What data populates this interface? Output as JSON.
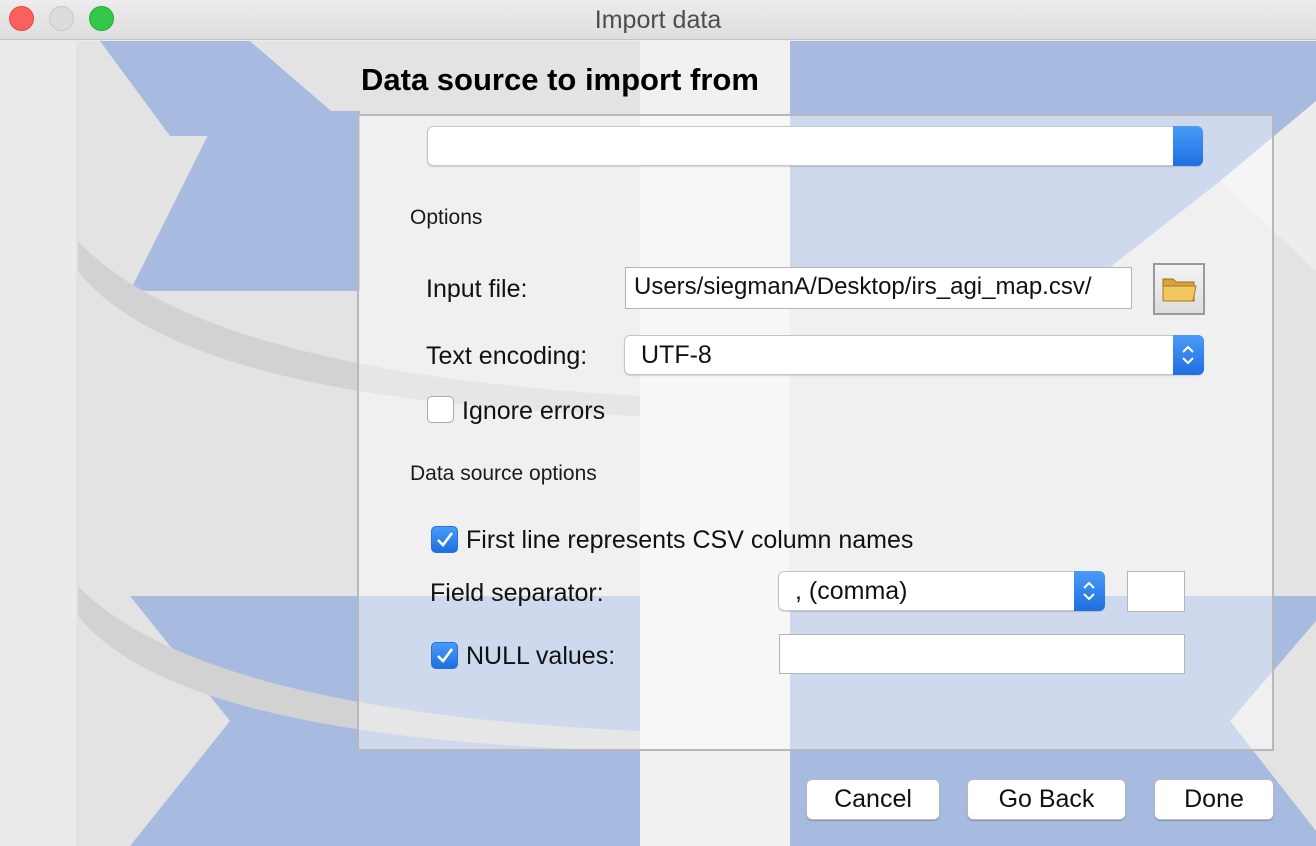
{
  "window": {
    "title": "Import data"
  },
  "page": {
    "heading": "Data source to import from"
  },
  "options": {
    "group_label": "Options",
    "input_file_label": "Input file:",
    "input_file_value": "/Users/siegmanA/Desktop/irs_agi_map.csv",
    "text_encoding_label": "Text encoding:",
    "text_encoding_value": "UTF-8",
    "ignore_errors_label": "Ignore errors",
    "ignore_errors_checked": false
  },
  "data_source_options": {
    "group_label": "Data source options",
    "first_line_label": "First line represents CSV column names",
    "first_line_checked": true,
    "field_separator_label": "Field separator:",
    "field_separator_value": ", (comma)",
    "custom_separator_value": "",
    "null_values_label": "NULL values:",
    "null_values_checked": true,
    "null_values_value": ""
  },
  "buttons": {
    "cancel": "Cancel",
    "go_back": "Go Back",
    "done": "Done"
  },
  "colors": {
    "accent": "#1e6fe0",
    "watermark_blue": "#a7badf"
  }
}
